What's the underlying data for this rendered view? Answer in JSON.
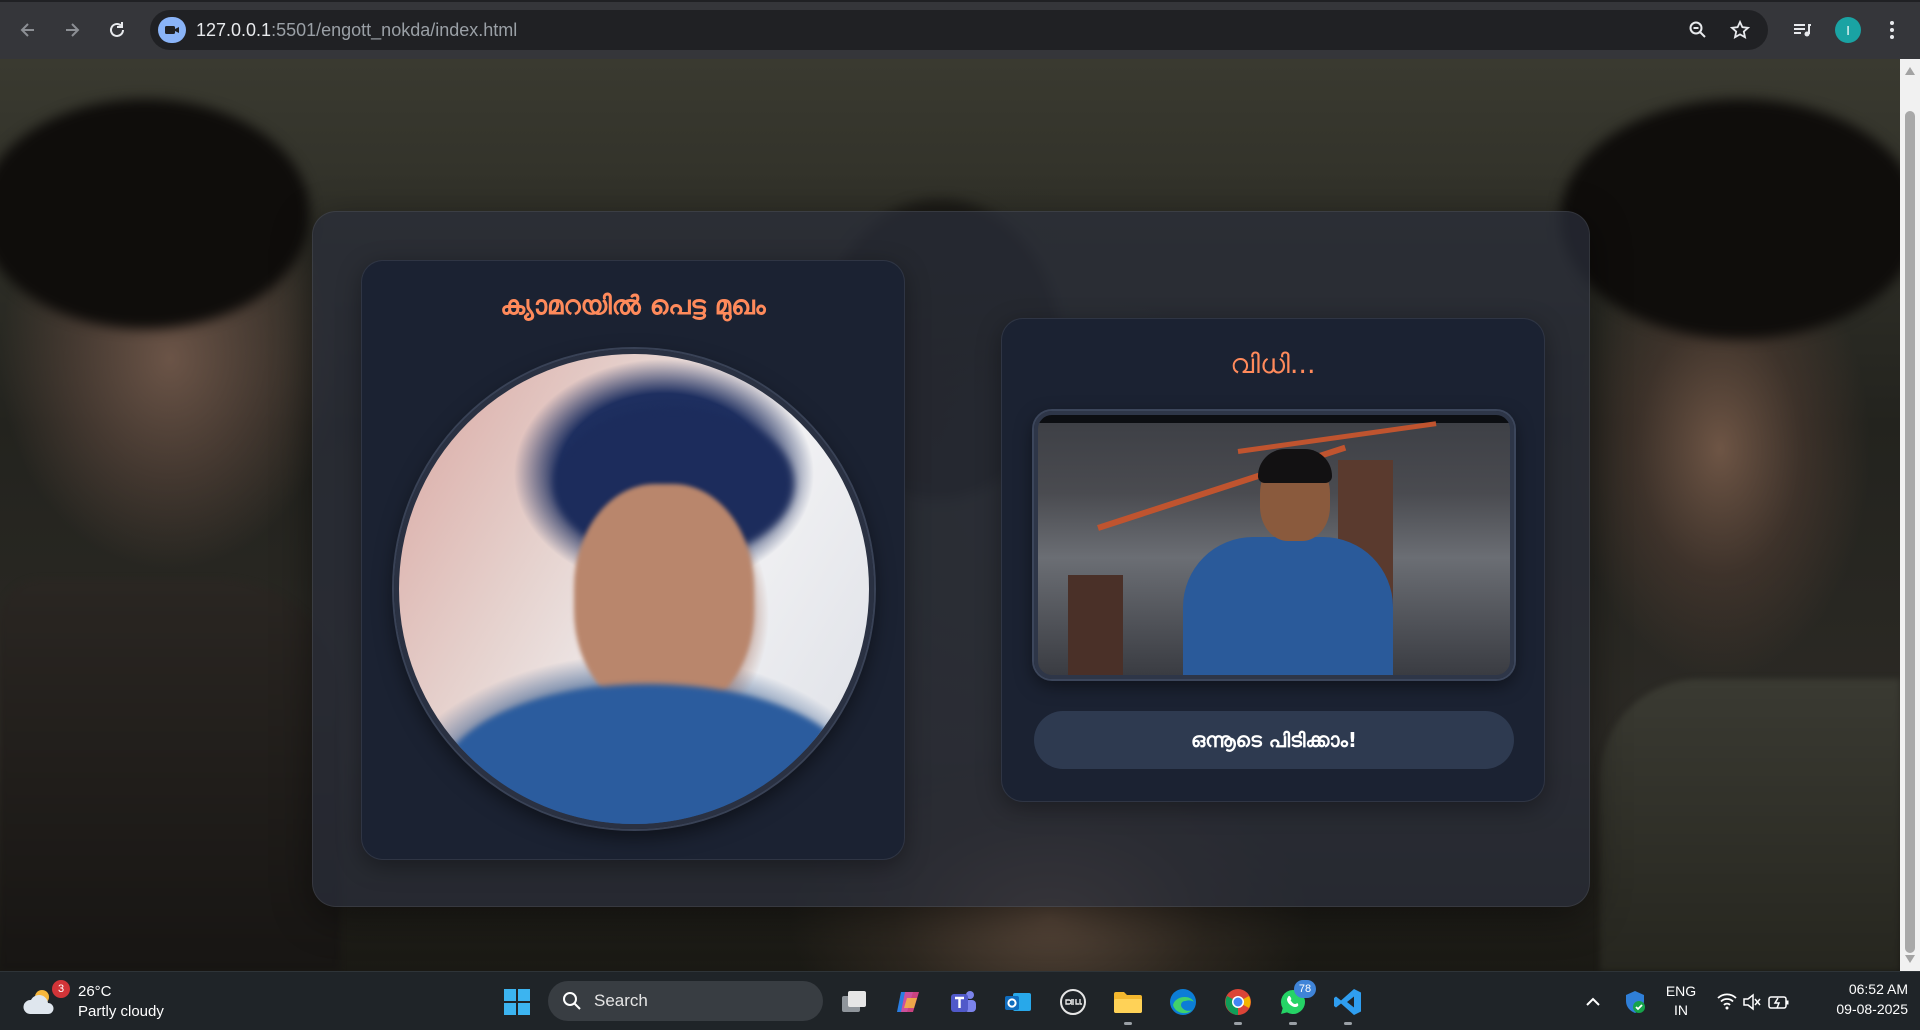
{
  "browser": {
    "url_host": "127.0.0.1",
    "url_path": ":5501/engott_nokda/index.html",
    "profile_initial": "I"
  },
  "app": {
    "face_card": {
      "title": "ക്യാമറയിൽ പെട്ട മുഖം"
    },
    "fate_card": {
      "title": "വിധി...",
      "retry_button": "ഒന്നൂടെ പിടിക്കാം!"
    },
    "accent_color": "#ff8a5b"
  },
  "taskbar": {
    "weather": {
      "temp": "26°C",
      "condition": "Partly cloudy",
      "badge": "3"
    },
    "search_label": "Search",
    "whatsapp_badge": "78",
    "language": {
      "line1": "ENG",
      "line2": "IN"
    },
    "clock": {
      "time": "06:52 AM",
      "date": "09-08-2025"
    }
  }
}
